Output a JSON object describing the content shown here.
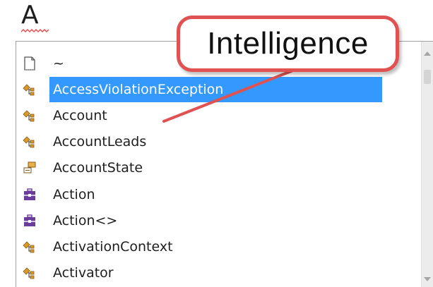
{
  "editor": {
    "typed_text": "A"
  },
  "completion_list": {
    "items": [
      {
        "label": "~",
        "icon": "file-icon",
        "selected": false
      },
      {
        "label": "AccessViolationException",
        "icon": "class-icon",
        "selected": true
      },
      {
        "label": "Account",
        "icon": "class-icon",
        "selected": false
      },
      {
        "label": "AccountLeads",
        "icon": "class-icon",
        "selected": false
      },
      {
        "label": "AccountState",
        "icon": "enum-icon",
        "selected": false
      },
      {
        "label": "Action",
        "icon": "delegate-icon",
        "selected": false
      },
      {
        "label": "Action<>",
        "icon": "delegate-icon",
        "selected": false
      },
      {
        "label": "ActivationContext",
        "icon": "class-icon",
        "selected": false
      },
      {
        "label": "Activator",
        "icon": "class-icon",
        "selected": false
      }
    ]
  },
  "callout": {
    "text": "Intelligence"
  },
  "colors": {
    "selection": "#3399ff",
    "callout_border": "#e05252",
    "class_icon": "#d99a2b",
    "delegate_icon": "#6a3d9a",
    "squiggle": "#e05252"
  }
}
